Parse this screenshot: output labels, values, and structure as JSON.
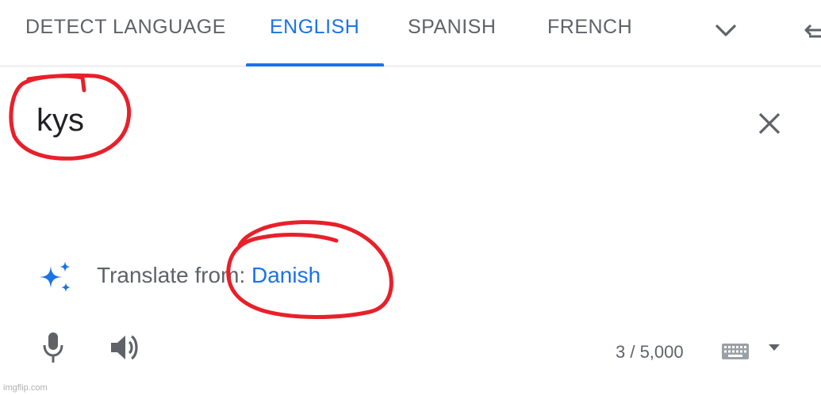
{
  "tabs": [
    {
      "label": "DETECT LANGUAGE",
      "active": false
    },
    {
      "label": "ENGLISH",
      "active": true
    },
    {
      "label": "SPANISH",
      "active": false
    },
    {
      "label": "FRENCH",
      "active": false
    }
  ],
  "source": {
    "text": "kys"
  },
  "suggestion": {
    "prefix": "Translate from: ",
    "language": "Danish"
  },
  "counter": "3 / 5,000",
  "watermark": "imgflip.com",
  "colors": {
    "accent": "#1a73e8",
    "annotation": "#e8202a",
    "text": "#3c4043",
    "muted": "#5f6368"
  },
  "icons": [
    "chevron-down-icon",
    "swap-languages-icon",
    "close-icon",
    "sparkle-icon",
    "microphone-icon",
    "speaker-icon",
    "keyboard-icon",
    "caret-down-icon"
  ]
}
